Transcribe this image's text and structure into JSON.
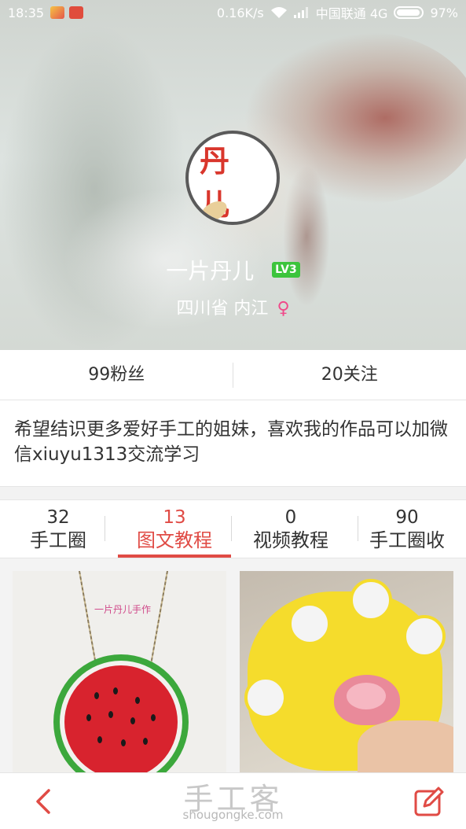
{
  "status_bar": {
    "time": "18:35",
    "speed": "0.16K/s",
    "carrier": "中国联通 4G",
    "battery": "97%"
  },
  "profile": {
    "avatar_text": "丹 儿",
    "username": "一片丹儿",
    "level": "LV3",
    "location": "四川省 内江",
    "gender_symbol": "♀"
  },
  "stats": {
    "fans": "99粉丝",
    "following": "20关注"
  },
  "bio": "希望结识更多爱好手工的姐妹，喜欢我的作品可以加微信xiuyu1313交流学习",
  "tabs": [
    {
      "count": "32",
      "label": "手工圈",
      "active": false
    },
    {
      "count": "13",
      "label": "图文教程",
      "active": true
    },
    {
      "count": "0",
      "label": "视频教程",
      "active": false
    },
    {
      "count": "90",
      "label": "手工圈收",
      "active": false
    }
  ],
  "cards": [
    {
      "label": "一片丹儿手作",
      "subject": "watermelon crochet bag"
    },
    {
      "subject": "yellow paw crochet purse"
    }
  ],
  "watermark": {
    "logo": "手工客",
    "site": "shougongke.com"
  },
  "colors": {
    "accent": "#e04b45",
    "level_badge": "#3cc43c",
    "gender": "#f04a8a"
  },
  "icons": {
    "back": "chevron-left-icon",
    "edit": "edit-icon"
  }
}
